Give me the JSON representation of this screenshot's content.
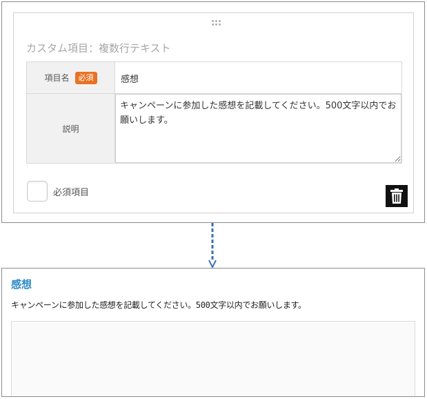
{
  "editor": {
    "title": "カスタム項目：複数行テキスト",
    "name_label": "項目名",
    "required_badge": "必須",
    "name_value": "感想",
    "desc_label": "説明",
    "desc_value": "キャンペーンに参加した感想を記載してください。500文字以内でお願いします。",
    "required_checkbox_label": "必須項目",
    "required_checked": false,
    "delete_icon": "trash-icon",
    "drag_icon": "drag-handle-icon"
  },
  "preview": {
    "title": "感想",
    "description": "キャンペーンに参加した感想を記載してください。500文字以内でお願いします。",
    "textarea_value": ""
  },
  "colors": {
    "badge": "#e87224",
    "preview_title": "#2d8ac6",
    "arrow": "#3b6fb6",
    "delete_button": "#111111"
  }
}
